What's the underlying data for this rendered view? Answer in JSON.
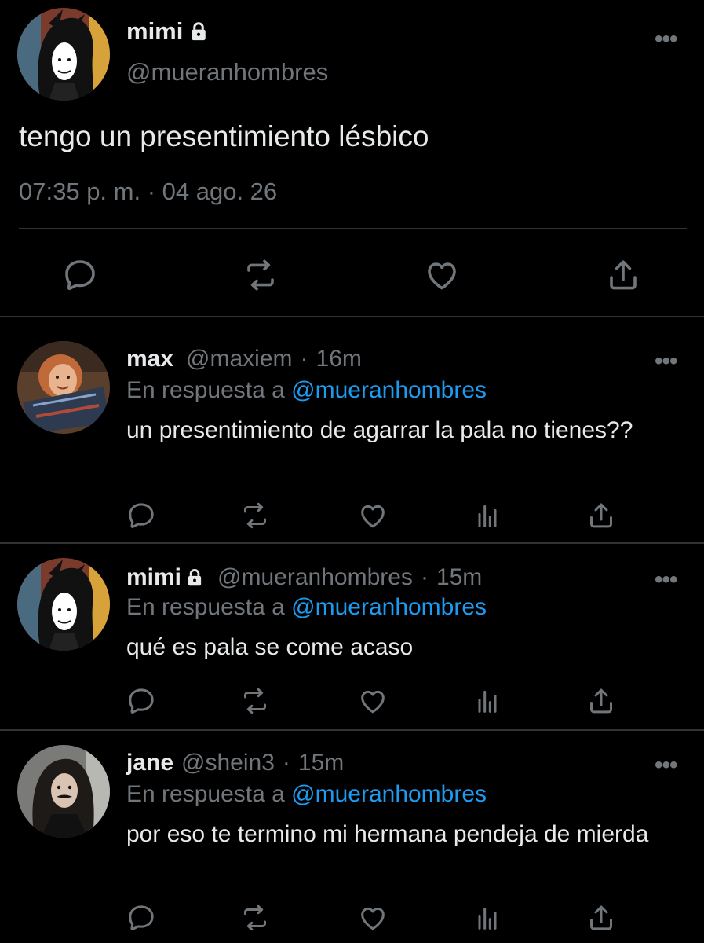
{
  "main_tweet": {
    "name": "mimi",
    "handle": "@mueranhombres",
    "text": "tengo un presentimiento lésbico",
    "timestamp": "07:35 p. m. · 04 ago. 26",
    "icons": [
      "reply-icon",
      "retweet-icon",
      "like-icon",
      "share-icon"
    ]
  },
  "replies": [
    {
      "name": "max",
      "handle": "@maxiem",
      "separator": "·",
      "time": "16m",
      "in_reply_prefix": "En respuesta a",
      "in_reply_mention": "@mueranhombres",
      "text": "un presentimiento de agarrar la pala no tienes??"
    },
    {
      "name": "mimi",
      "handle": "@mueranhombres",
      "separator": "·",
      "time": "15m",
      "in_reply_prefix": "En respuesta a",
      "in_reply_mention": "@mueranhombres",
      "text": "qué es pala se come acaso"
    },
    {
      "name": "jane",
      "handle": "@shein3",
      "separator": "·",
      "time": "15m",
      "in_reply_prefix": "En respuesta a",
      "in_reply_mention": "@mueranhombres",
      "text": "por eso te termino mi hermana pendeja de mierda"
    }
  ],
  "more_label": "•••",
  "colors": {
    "background": "#000000",
    "text": "#e7e9ea",
    "secondary": "#71767b",
    "link": "#1d9bf0",
    "divider": "#2f3336"
  }
}
